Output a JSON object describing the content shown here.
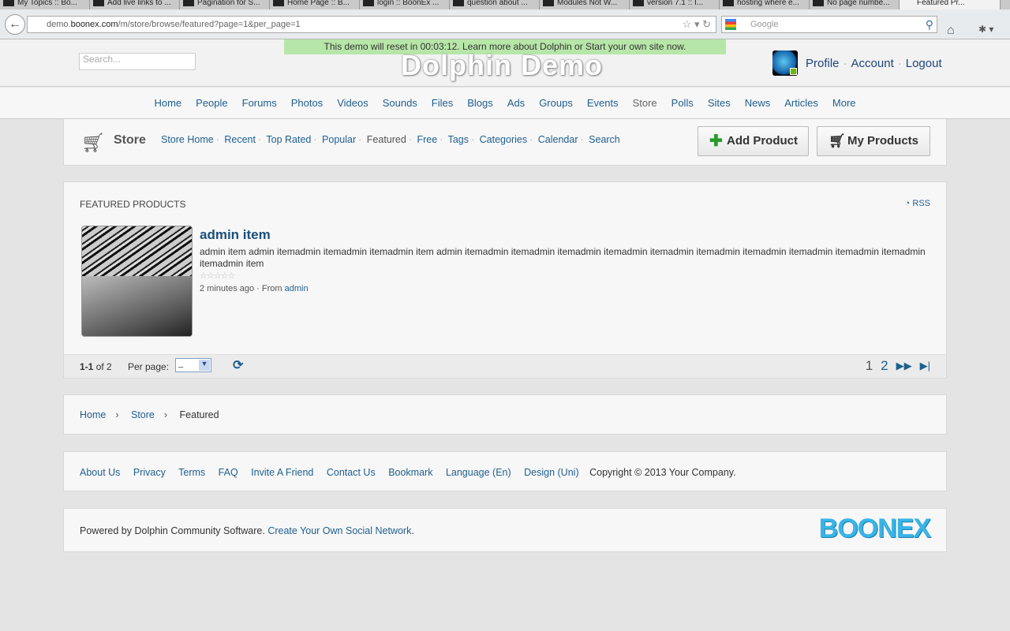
{
  "browser": {
    "tabs": [
      "My Topics :: Bo...",
      "Add live links to ...",
      "Pagination for S...",
      "Home Page :: B...",
      "login :: BoonEx ...",
      "question about ...",
      "Modules Not W...",
      "version 7.1 :: I...",
      "hosting where e...",
      "No page numbe...",
      "Featured Pr..."
    ],
    "url_prefix": "demo.",
    "url_domain": "boonex.com",
    "url_path": "/m/store/browse/featured?page=1&per_page=1",
    "search_placeholder": "Google"
  },
  "header": {
    "notice": "This demo will reset in 00:03:12. Learn more about Dolphin or Start your own site now.",
    "search_placeholder": "Search...",
    "logo": "Dolphin Demo",
    "user_links": [
      "Profile",
      "Account",
      "Logout"
    ]
  },
  "nav": [
    "Home",
    "People",
    "Forums",
    "Photos",
    "Videos",
    "Sounds",
    "Files",
    "Blogs",
    "Ads",
    "Groups",
    "Events",
    "Store",
    "Polls",
    "Sites",
    "News",
    "Articles",
    "More"
  ],
  "store": {
    "title": "Store",
    "submenu": [
      "Store Home",
      "Recent",
      "Top Rated",
      "Popular",
      "Featured",
      "Free",
      "Tags",
      "Categories",
      "Calendar",
      "Search"
    ],
    "add_product": "Add Product",
    "my_products": "My Products"
  },
  "featured": {
    "title": "FEATURED PRODUCTS",
    "rss": "RSS",
    "item": {
      "title": "admin item",
      "description": "admin item admin itemadmin itemadmin itemadmin item admin itemadmin itemadmin itemadmin itemadmin itemadmin itemadmin itemadmin itemadmin itemadmin itemadmin itemadmin item",
      "rating": 0,
      "time": "2 minutes ago",
      "from_label": "From",
      "author": "admin"
    },
    "pager": {
      "range": "1-1",
      "of": "of 2",
      "per_page_label": "Per page:",
      "per_page_value": "_",
      "pages": [
        "1",
        "2"
      ],
      "current": "1"
    }
  },
  "breadcrumb": [
    "Home",
    "Store",
    "Featured"
  ],
  "footer": {
    "links": [
      "About Us",
      "Privacy",
      "Terms",
      "FAQ",
      "Invite A Friend",
      "Contact Us",
      "Bookmark",
      "Language (En)",
      "Design (Uni)"
    ],
    "copyright": "Copyright © 2013 Your Company.",
    "powered": "Powered by Dolphin Community Software.",
    "create_link": "Create Your Own Social Network",
    "brand": "BOONEX"
  }
}
